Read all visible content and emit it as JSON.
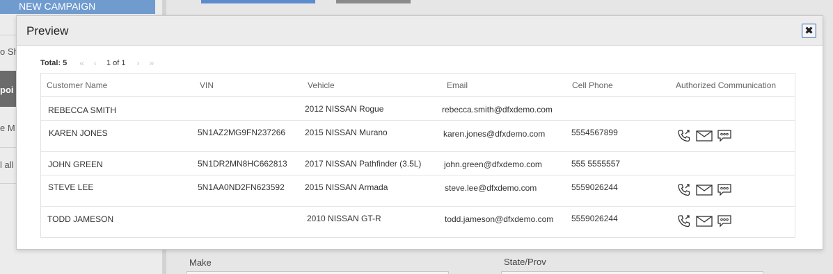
{
  "background": {
    "new_campaign_label": "NEW CAMPAIGN",
    "side_items": [
      "o Sh",
      "poi",
      "e M",
      "l all"
    ],
    "make_label": "Make",
    "state_label": "State/Prov"
  },
  "modal": {
    "title": "Preview",
    "close_icon": "close-icon",
    "pager": {
      "total_label": "Total: 5",
      "page_info": "1 of 1"
    },
    "columns": [
      "Customer Name",
      "VIN",
      "Vehicle",
      "Email",
      "Cell Phone",
      "Authorized Communication"
    ],
    "rows": [
      {
        "name": "REBECCA SMITH",
        "vin": "",
        "vehicle": "2012 NISSAN Rogue",
        "email": "rebecca.smith@dfxdemo.com",
        "phone": "",
        "comm": false
      },
      {
        "name": "KAREN JONES",
        "vin": "5N1AZ2MG9FN237266",
        "vehicle": "2015 NISSAN Murano",
        "email": "karen.jones@dfxdemo.com",
        "phone": "5554567899",
        "comm": true
      },
      {
        "name": "JOHN GREEN",
        "vin": "5N1DR2MN8HC662813",
        "vehicle": "2017 NISSAN Pathfinder (3.5L)",
        "email": "john.green@dfxdemo.com",
        "phone": "555 5555557",
        "comm": false
      },
      {
        "name": "STEVE LEE",
        "vin": "5N1AA0ND2FN623592",
        "vehicle": "2015 NISSAN Armada",
        "email": "steve.lee@dfxdemo.com",
        "phone": "5559026244",
        "comm": true
      },
      {
        "name": "TODD JAMESON",
        "vin": "",
        "vehicle": "2010 NISSAN GT-R",
        "email": "todd.jameson@dfxdemo.com",
        "phone": "5559026244",
        "comm": true
      }
    ]
  }
}
